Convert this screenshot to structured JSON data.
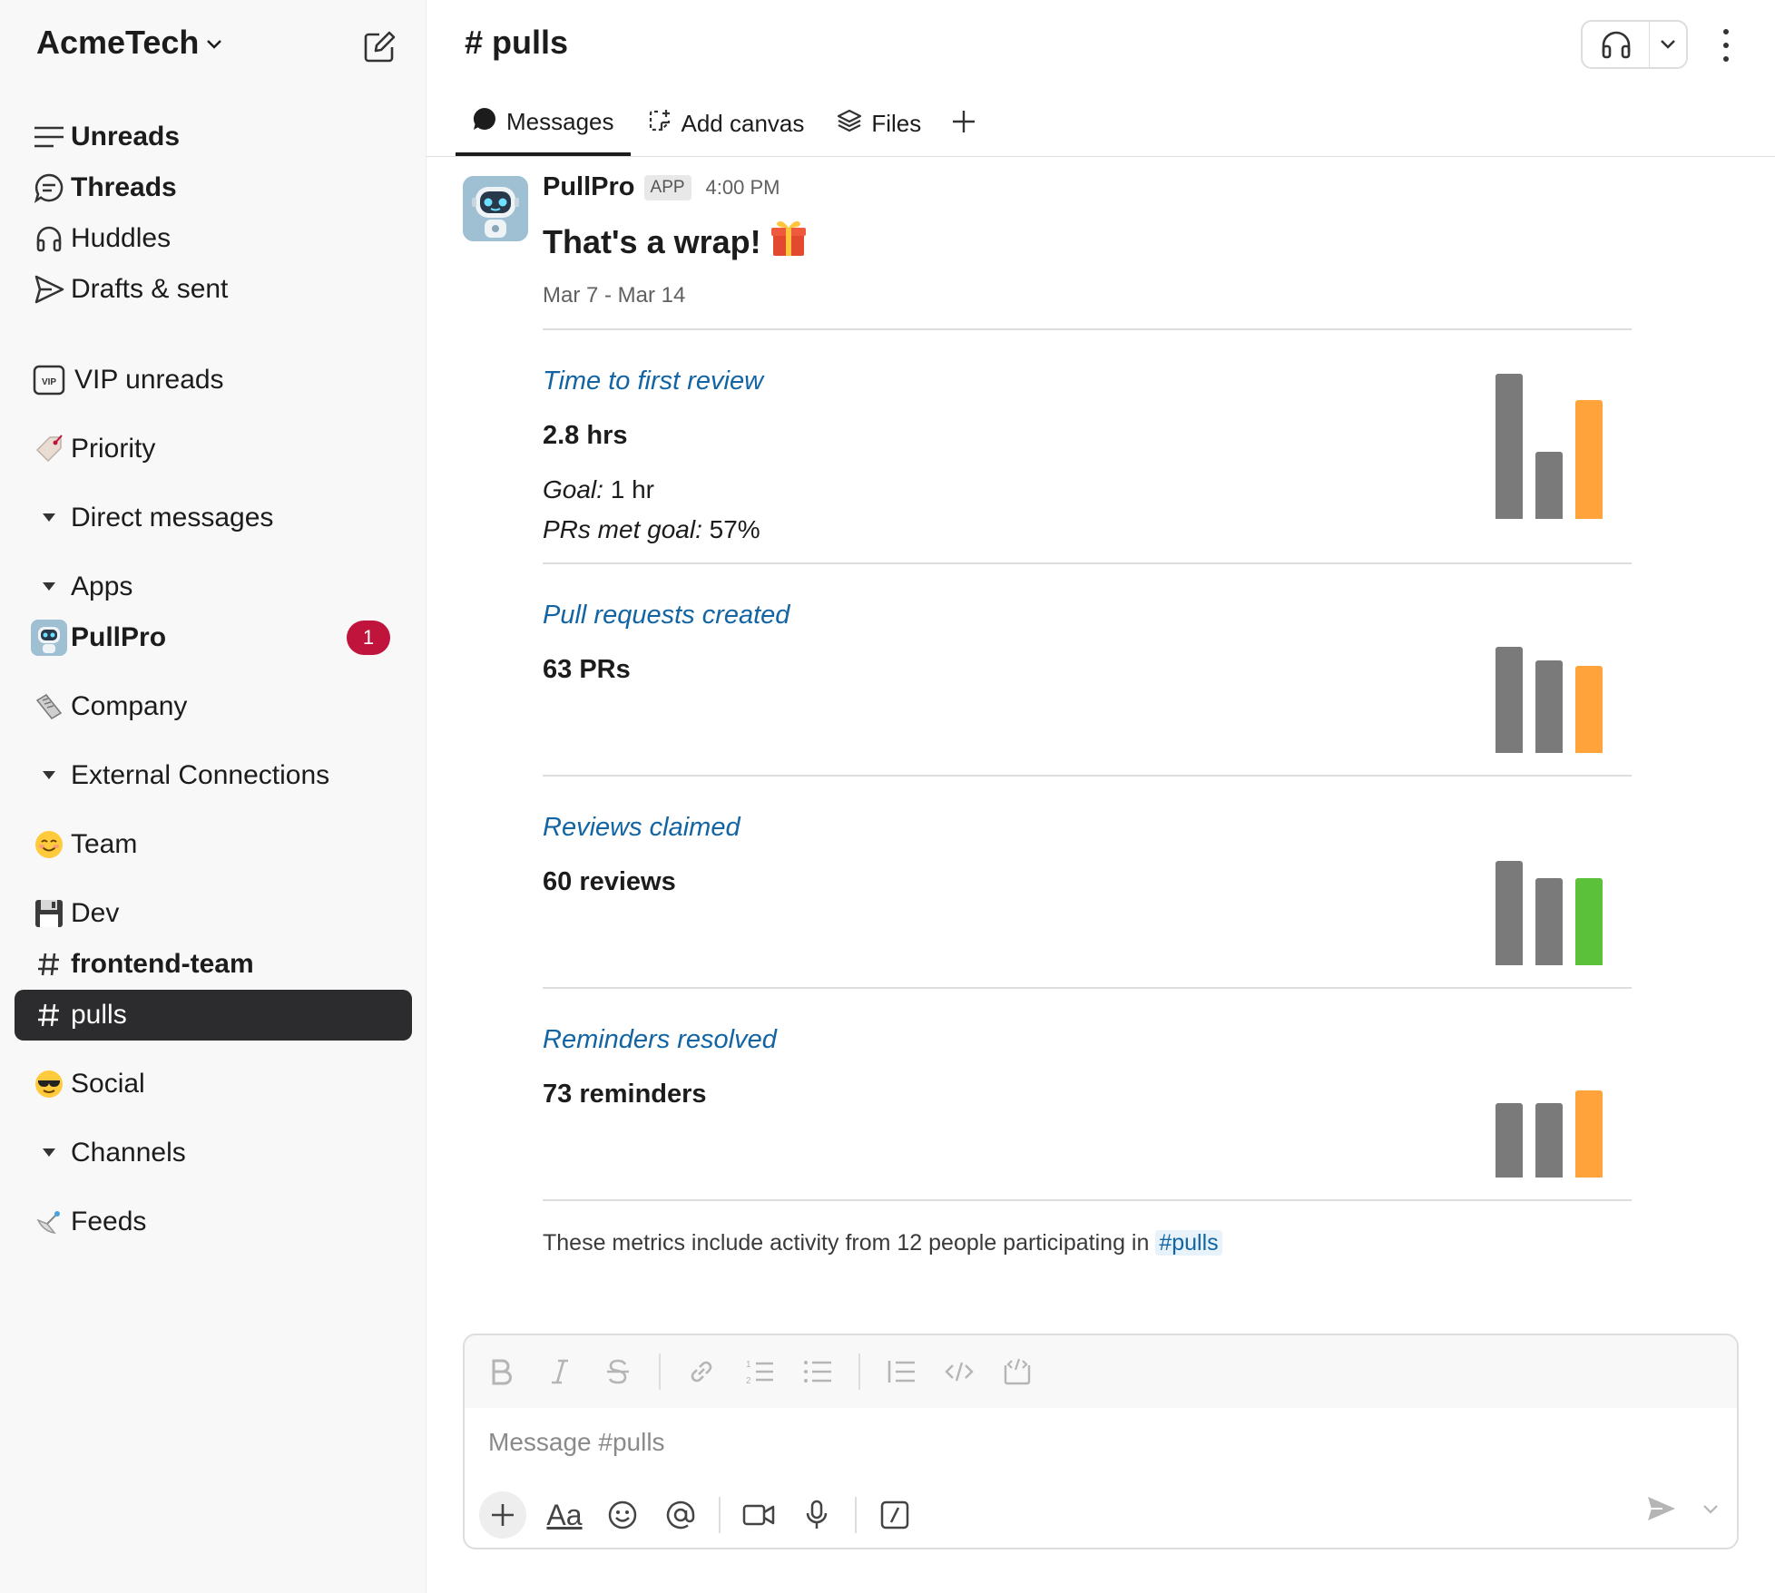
{
  "workspace": {
    "name": "AcmeTech"
  },
  "sidebar": {
    "items": [
      {
        "label": "Unreads"
      },
      {
        "label": "Threads"
      },
      {
        "label": "Huddles"
      },
      {
        "label": "Drafts & sent"
      },
      {
        "label": "VIP unreads"
      },
      {
        "label": "Priority"
      },
      {
        "label": "Direct messages"
      },
      {
        "label": "Apps"
      },
      {
        "label": "PullPro",
        "badge": "1"
      },
      {
        "label": "Company"
      },
      {
        "label": "External Connections"
      },
      {
        "label": "Team"
      },
      {
        "label": "Dev"
      },
      {
        "label": "frontend-team"
      },
      {
        "label": "pulls"
      },
      {
        "label": "Social"
      },
      {
        "label": "Channels"
      },
      {
        "label": "Feeds"
      }
    ]
  },
  "channel": {
    "title": "# pulls",
    "tabs": [
      {
        "label": "Messages"
      },
      {
        "label": "Add canvas"
      },
      {
        "label": "Files"
      }
    ]
  },
  "message": {
    "sender": "PullPro",
    "app_tag": "APP",
    "time": "4:00 PM",
    "title": "That's a wrap!",
    "title_emoji": "🎁",
    "date_range": "Mar 7 - Mar 14",
    "metrics": [
      {
        "title": "Time to first review",
        "value": "2.8 hrs",
        "goal_label": "Goal:",
        "goal_value": " 1 hr",
        "met_label": "PRs met goal:",
        "met_value": " 57%",
        "bars": [
          1.0,
          0.46,
          0.82
        ],
        "bar_colors": [
          "#7a7a7a",
          "#7a7a7a",
          "#ffa33a"
        ]
      },
      {
        "title": "Pull requests created",
        "value": "63 PRs",
        "bars": [
          0.73,
          0.64,
          0.6
        ],
        "bar_colors": [
          "#7a7a7a",
          "#7a7a7a",
          "#ffa33a"
        ]
      },
      {
        "title": "Reviews claimed",
        "value": "60 reviews",
        "bars": [
          0.72,
          0.6,
          0.6
        ],
        "bar_colors": [
          "#7a7a7a",
          "#7a7a7a",
          "#5cc13a"
        ]
      },
      {
        "title": "Reminders resolved",
        "value": "73 reminders",
        "bars": [
          0.51,
          0.51,
          0.6
        ],
        "bar_colors": [
          "#7a7a7a",
          "#7a7a7a",
          "#ffa33a"
        ]
      }
    ],
    "footnote": "These metrics include activity from 12 people participating in ",
    "footnote_link": "#pulls"
  },
  "composer": {
    "placeholder": "Message #pulls",
    "font_toggle": "Aa"
  },
  "colors": {
    "accent_blue": "#1264a3",
    "badge_red": "#c0143c",
    "active_bg": "#2c2c2e",
    "bar_gray": "#7a7a7a",
    "bar_orange": "#ffa33a",
    "bar_green": "#5cc13a"
  }
}
